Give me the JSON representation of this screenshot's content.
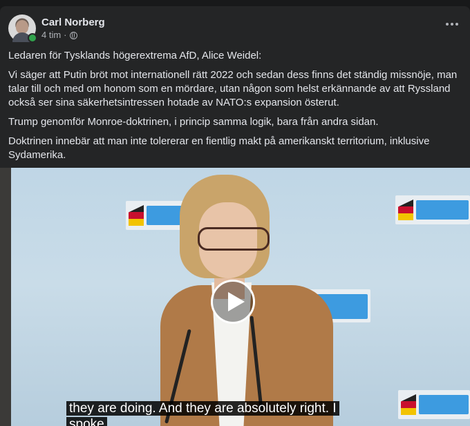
{
  "post": {
    "author": "Carl Norberg",
    "time": "4 tim",
    "separator": "·",
    "paragraphs": [
      "Ledaren för Tysklands högerextrema AfD, Alice Weidel:",
      "Vi säger att Putin bröt mot internationell rätt 2022 och sedan dess finns det ständig missnöje, man talar till och med om honom som en mördare, utan någon som helst erkännande av att Ryssland också ser sina säkerhetsintressen hotade av NATO:s expansion österut.",
      "Trump genomför Monroe-doktrinen, i princip samma logik, bara från andra sidan.",
      "Doktrinen innebär att man inte tolererar en fientlig makt på amerikanskt territorium, inklusive Sydamerika."
    ]
  },
  "video": {
    "caption_line1": "they are doing.  And they are absolutely right.  I",
    "caption_line2": "spoke"
  },
  "icons": {
    "privacy": "globe-icon",
    "more": "more-options-icon",
    "play": "play-icon"
  },
  "colors": {
    "card_bg": "#242526",
    "page_bg": "#18191a",
    "text": "#e4e6eb",
    "secondary_text": "#b0b3b8",
    "online": "#31a24c"
  }
}
